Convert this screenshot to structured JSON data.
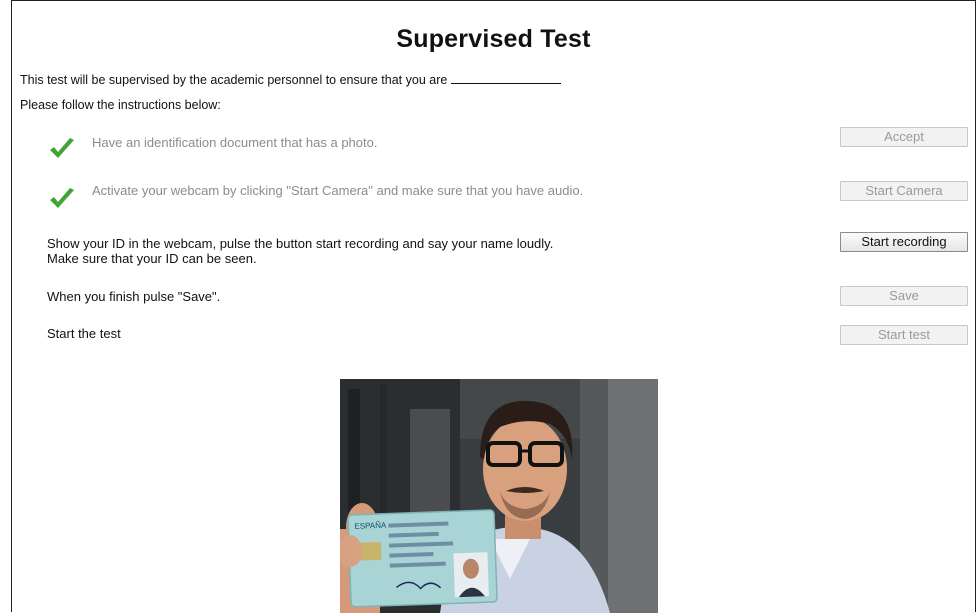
{
  "page": {
    "title": "Supervised Test",
    "intro": "This test will be supervised by the academic personnel to ensure that you are",
    "follow": "Please follow the instructions below:"
  },
  "steps": [
    {
      "text": "Have an identification document that has a photo.",
      "done": true,
      "button": "Accept",
      "button_enabled": false
    },
    {
      "text": "Activate your webcam by clicking \"Start Camera\" and make sure that you have audio.",
      "done": true,
      "button": "Start Camera",
      "button_enabled": false
    },
    {
      "text_a": "Show your ID in the webcam, pulse the button start recording and say your name loudly.",
      "text_b": "Make sure that your ID can be seen.",
      "done": false,
      "button": "Start recording",
      "button_enabled": true
    },
    {
      "text": "When you finish pulse \"Save\".",
      "done": false,
      "button": "Save",
      "button_enabled": false
    },
    {
      "text": "Start the test",
      "done": false,
      "button": "Start test",
      "button_enabled": false
    }
  ],
  "colors": {
    "check_green": "#3fa535",
    "disabled_text": "#8c8c8c"
  },
  "icons": {
    "check": "check-icon"
  },
  "webcam": {
    "card_country": "ESPAÑA"
  }
}
